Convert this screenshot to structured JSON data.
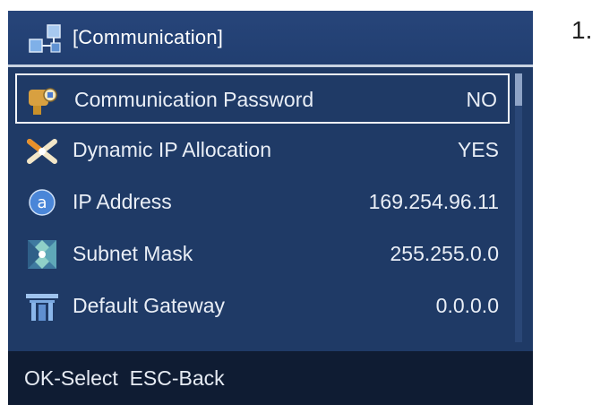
{
  "header": {
    "title": "[Communication]",
    "icon": "network-icon"
  },
  "menu": {
    "items": [
      {
        "label": "Communication Password",
        "value": "NO",
        "icon": "key-icon",
        "selected": true
      },
      {
        "label": "Dynamic IP Allocation",
        "value": "YES",
        "icon": "dhcp-icon",
        "selected": false
      },
      {
        "label": "IP Address",
        "value": "169.254.96.11",
        "icon": "ip-address-icon",
        "selected": false
      },
      {
        "label": "Subnet Mask",
        "value": "255.255.0.0",
        "icon": "subnet-mask-icon",
        "selected": false
      },
      {
        "label": "Default Gateway",
        "value": "0.0.0.0",
        "icon": "gateway-icon",
        "selected": false
      }
    ]
  },
  "footer": {
    "hint": "OK-Select  ESC-Back"
  },
  "step": {
    "number": "1."
  },
  "colors": {
    "screen_bg": "#1f3a66",
    "footer_bg": "#0f1c33",
    "text": "#e9eef6"
  }
}
